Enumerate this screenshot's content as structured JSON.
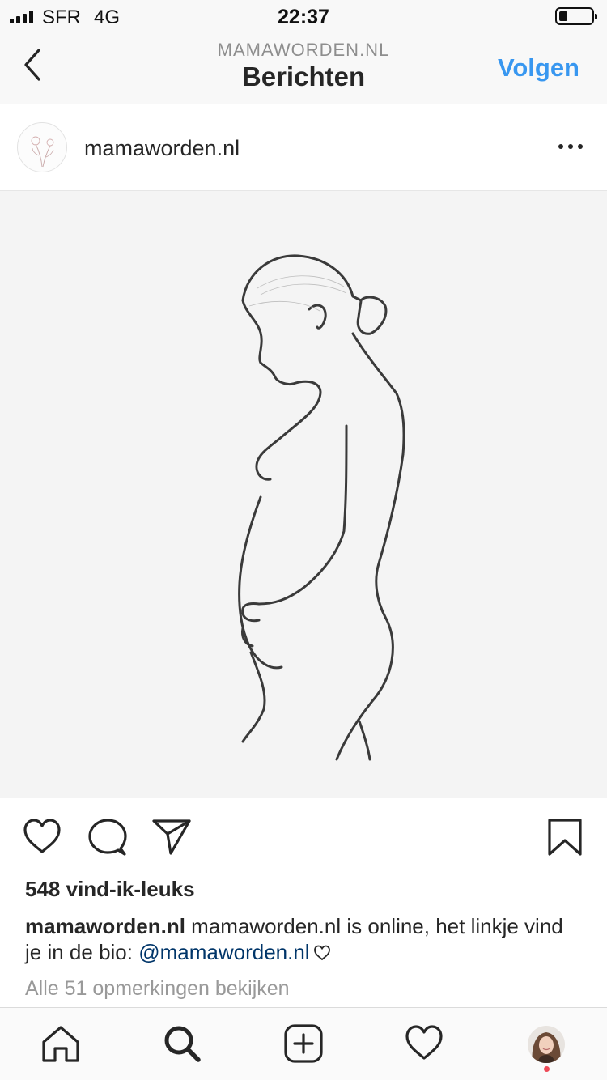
{
  "status_bar": {
    "carrier": "SFR",
    "network": "4G",
    "time": "22:37"
  },
  "header": {
    "subtitle": "MAMAWORDEN.NL",
    "title": "Berichten",
    "follow_label": "Volgen"
  },
  "post": {
    "username": "mamaworden.nl",
    "likes_text": "548 vind-ik-leuks",
    "caption_user": "mamaworden.nl",
    "caption_text": "mamaworden.nl is online, het linkje vind je in de bio:",
    "caption_mention": "@mamaworden.nl",
    "comments_link": "Alle 51 opmerkingen bekijken"
  },
  "colors": {
    "accent": "#3897f0",
    "mention": "#003569",
    "muted": "#999999",
    "notification": "#ed4956"
  },
  "icons": {
    "actions": [
      "heart-icon",
      "comment-icon",
      "share-icon",
      "bookmark-icon"
    ],
    "tabs": [
      "home-icon",
      "search-icon",
      "add-icon",
      "activity-heart-icon",
      "profile-avatar"
    ]
  }
}
